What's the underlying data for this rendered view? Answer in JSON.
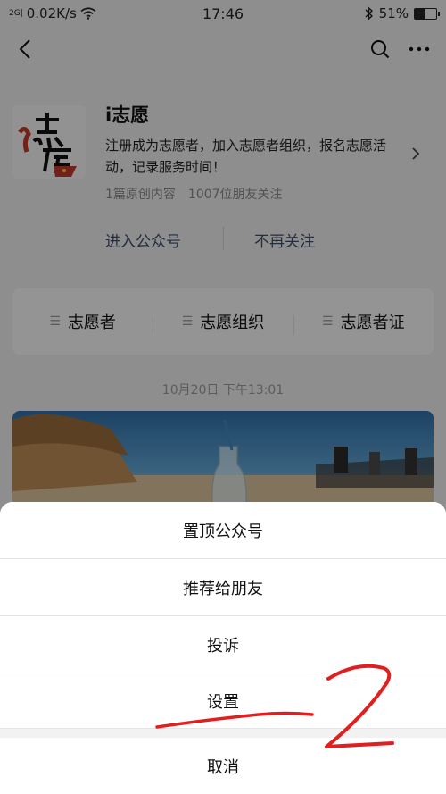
{
  "status_bar": {
    "network_label": "2G|",
    "speed": "0.02K/s",
    "time": "17:46",
    "battery": "51%",
    "battery_level": 0.51
  },
  "nav": {
    "back_icon": "chevron-left-icon",
    "search_icon": "search-icon",
    "more_icon": "more-horizontal-icon"
  },
  "profile": {
    "name": "i志愿",
    "description": "注册成为志愿者，加入志愿者组织，报名志愿活动，记录服务时间！",
    "article_count": "1篇原创内容",
    "followers": "1007位朋友关注",
    "enter_label": "进入公众号",
    "unfollow_label": "不再关注"
  },
  "menu": {
    "items": [
      {
        "label": "志愿者"
      },
      {
        "label": "志愿组织"
      },
      {
        "label": "志愿者证"
      }
    ]
  },
  "message_time": "10月20日 下午13:01",
  "action_sheet": {
    "items": [
      {
        "label": "置顶公众号"
      },
      {
        "label": "推荐给朋友"
      },
      {
        "label": "投诉"
      },
      {
        "label": "设置"
      }
    ],
    "cancel_label": "取消"
  },
  "annotation": {
    "color": "#e02020"
  }
}
